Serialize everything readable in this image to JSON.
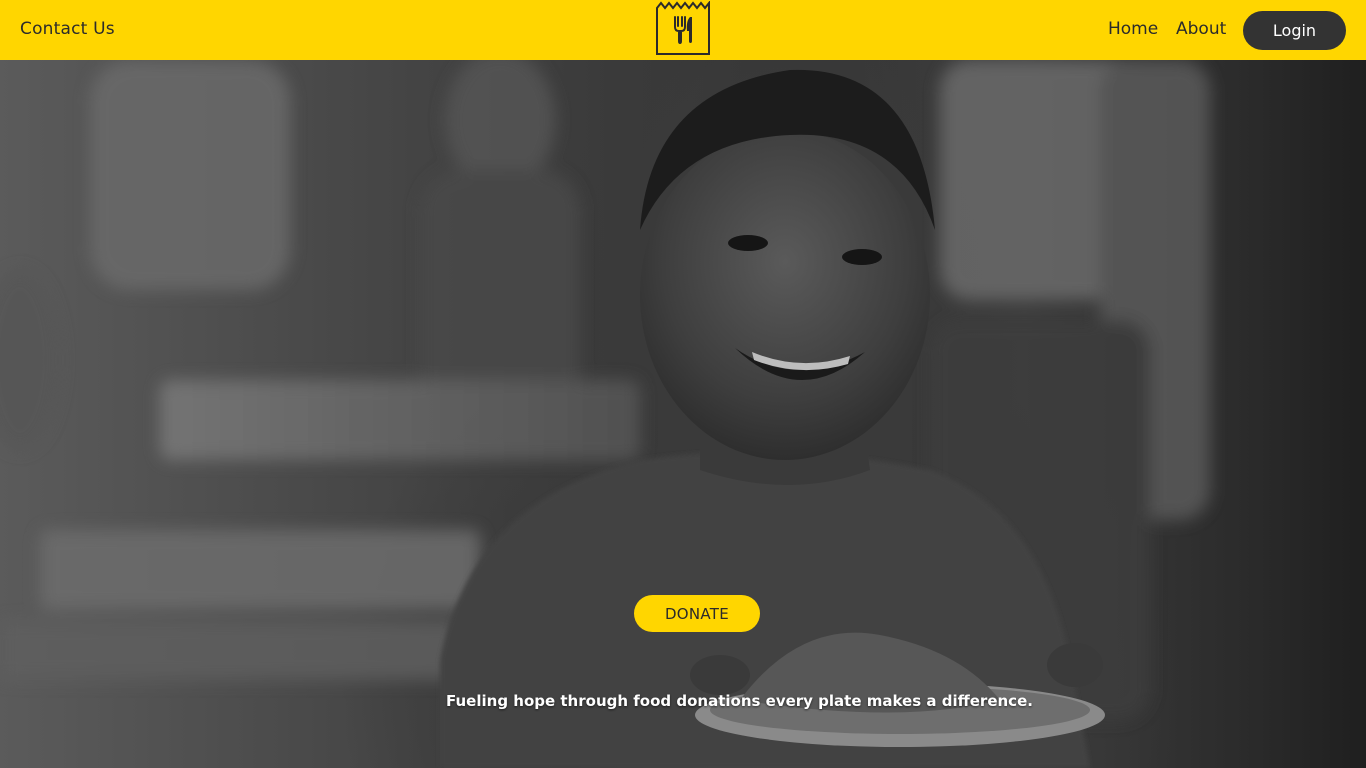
{
  "navbar": {
    "contact_label": "Contact Us",
    "home_label": "Home",
    "about_label": "About",
    "login_label": "Login",
    "logo_icon": "fork-knife-bag-icon",
    "background_color": "#ffd600",
    "login_button_color": "#333333"
  },
  "hero": {
    "image_description_icon": "hero-photo",
    "donate_label": "DONATE",
    "donate_color": "#ffd600",
    "tagline": "Fueling hope through food donations every plate makes a difference."
  }
}
